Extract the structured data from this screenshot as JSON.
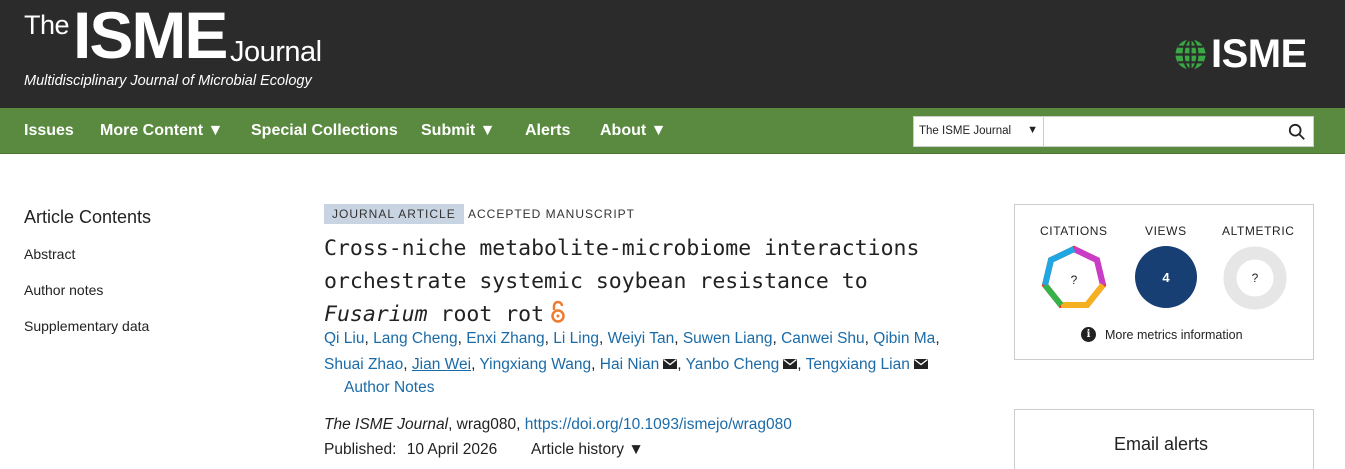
{
  "header": {
    "logo_the": "The",
    "logo_isme": "ISME",
    "logo_journal": "Journal",
    "logo_subtitle": "Multidisciplinary Journal of Microbial Ecology",
    "brand_text": "ISME",
    "brand_icon": "globe-icon"
  },
  "nav": {
    "items": [
      {
        "label": "Issues"
      },
      {
        "label": "More Content ▼"
      },
      {
        "label": "Special Collections"
      },
      {
        "label": "Submit ▼"
      },
      {
        "label": "Alerts"
      },
      {
        "label": "About ▼"
      }
    ],
    "search_scope": "The ISME Journal",
    "search_placeholder": ""
  },
  "sidebar": {
    "title": "Article Contents",
    "links": [
      "Abstract",
      "Author notes",
      "Supplementary data"
    ]
  },
  "article": {
    "type_badge": "JOURNAL ARTICLE",
    "status": "ACCEPTED MANUSCRIPT",
    "title_line1": "Cross-niche metabolite-microbiome interactions",
    "title_line2": "orchestrate systemic soybean resistance to",
    "title_italic": "Fusarium",
    "title_end": " root rot",
    "authors": [
      "Qi Liu",
      "Lang Cheng",
      "Enxi Zhang",
      "Li Ling",
      "Weiyi Tan",
      "Suwen Liang",
      "Canwei Shu",
      "Qibin Ma",
      "Shuai Zhao",
      "Jian Wei",
      "Yingxiang Wang",
      "Hai Nian",
      "Yanbo Cheng",
      "Tengxiang Lian"
    ],
    "author_notes": "Author Notes",
    "journal": "The ISME Journal",
    "article_id": ", wrag080, ",
    "doi": "https://doi.org/10.1093/ismejo/wrag080",
    "published_label": "Published:",
    "published_date": "10 April 2026",
    "history_label": "Article history ▼"
  },
  "metrics": {
    "citations_label": "CITATIONS",
    "citations_value": "?",
    "views_label": "VIEWS",
    "views_value": "4",
    "altmetric_label": "ALTMETRIC",
    "altmetric_value": "?",
    "more_label": "More metrics information",
    "views_color": "#173f73"
  },
  "alerts": {
    "title": "Email alerts"
  }
}
